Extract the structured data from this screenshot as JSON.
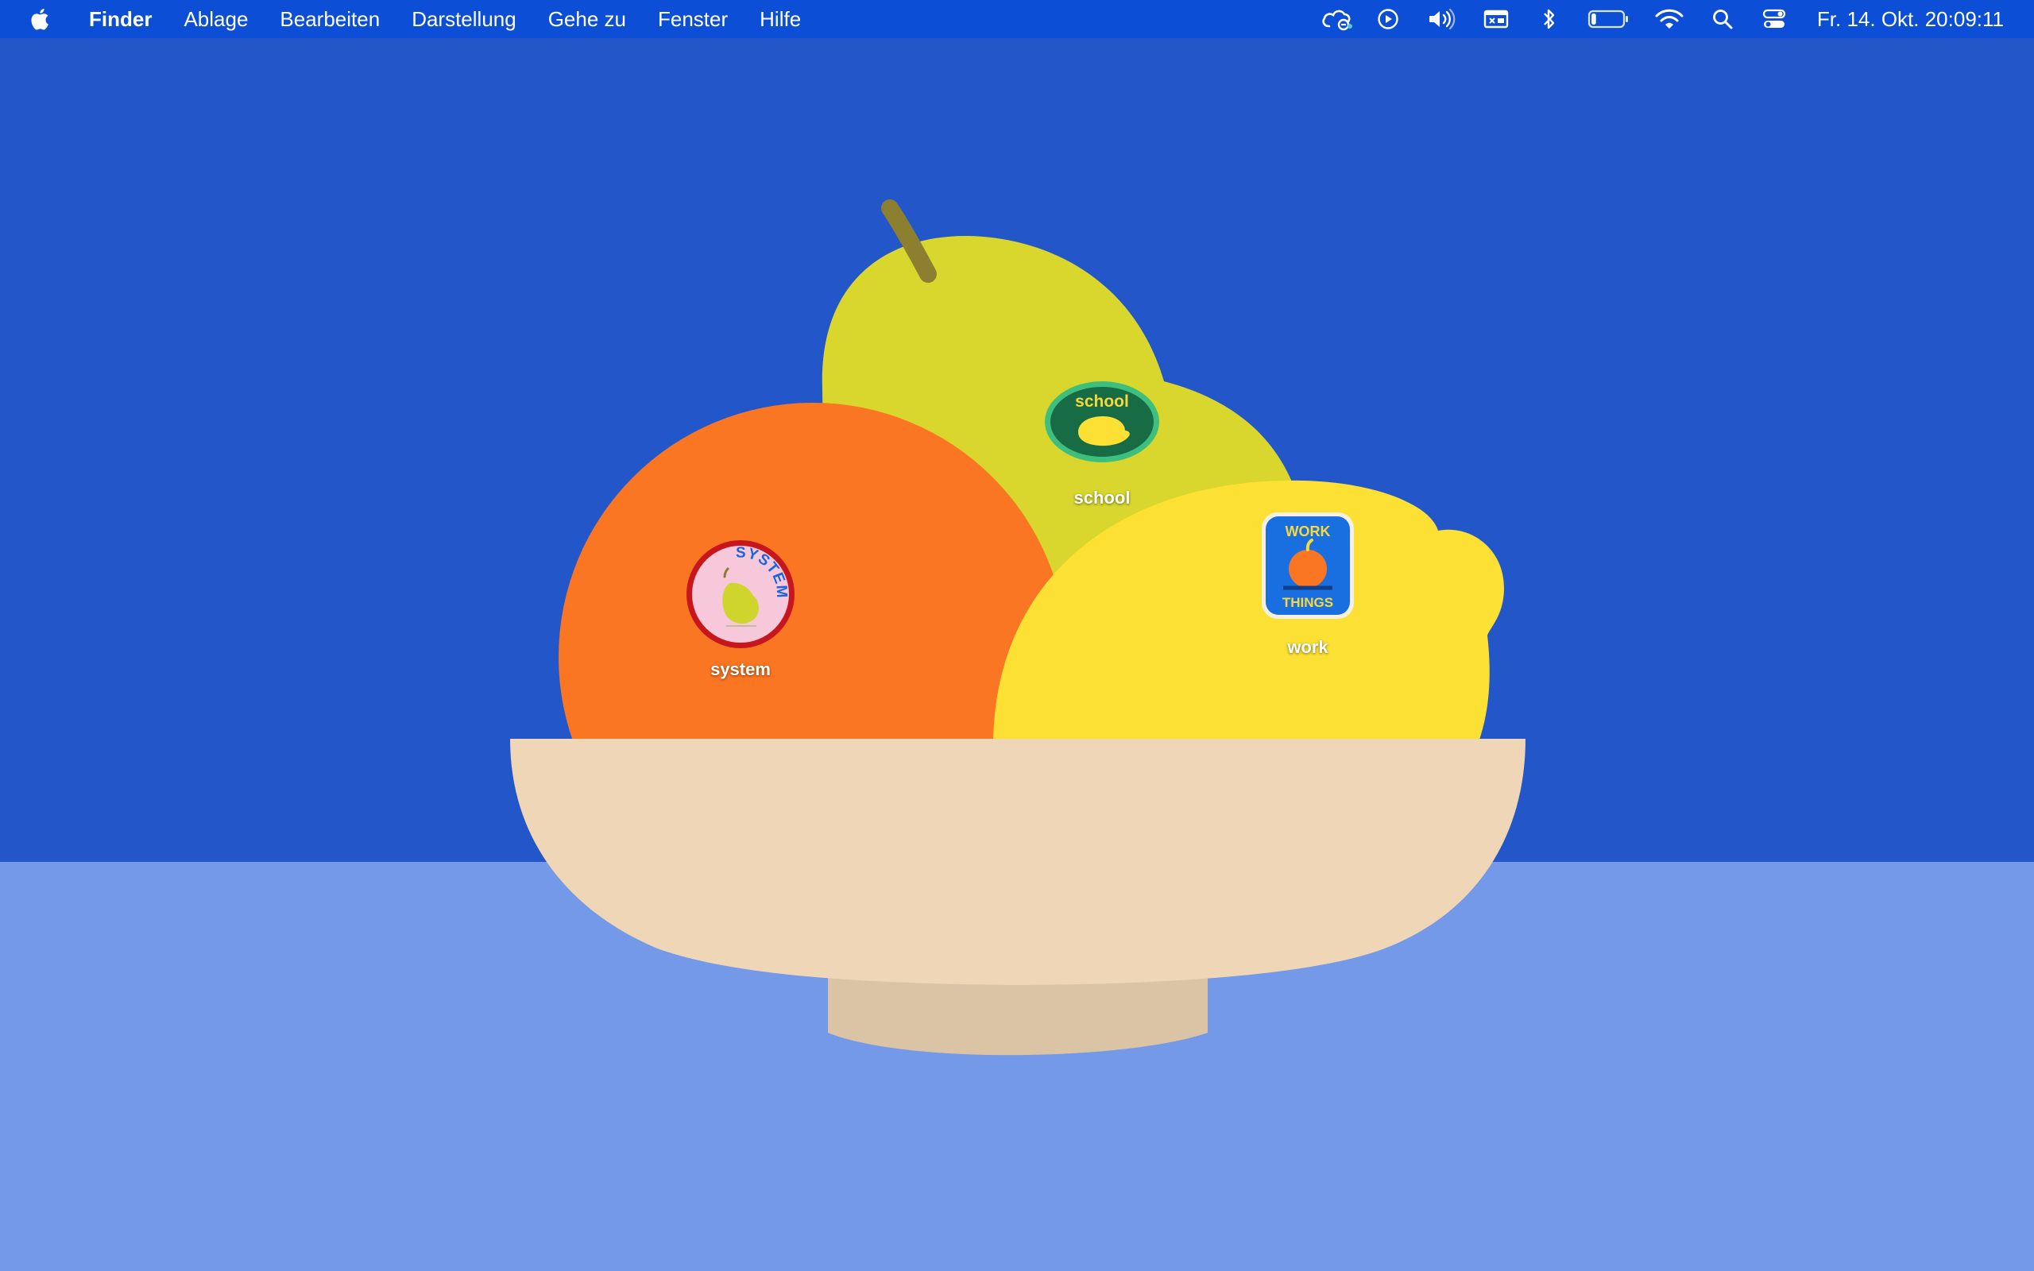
{
  "menubar": {
    "apple_icon": "apple-logo-icon",
    "items": [
      {
        "label": "Finder"
      },
      {
        "label": "Ablage"
      },
      {
        "label": "Bearbeiten"
      },
      {
        "label": "Darstellung"
      },
      {
        "label": "Gehe zu"
      },
      {
        "label": "Fenster"
      },
      {
        "label": "Hilfe"
      }
    ],
    "status_icons": [
      "creative-cloud-icon",
      "play-circle-icon",
      "volume-icon",
      "screen-mirroring-icon",
      "bluetooth-icon",
      "battery-icon",
      "wifi-icon",
      "search-icon",
      "control-center-icon"
    ],
    "battery_level": 0.15,
    "clock": "Fr. 14. Okt.  20:09:11"
  },
  "desktop": {
    "icons": [
      {
        "label": "system",
        "badge_text": "SYSTEM",
        "badge_color": "#c8161d"
      },
      {
        "label": "school",
        "badge_text": "school",
        "badge_color": "#176b45"
      },
      {
        "label": "work",
        "badge_text_top": "WORK",
        "badge_text_bottom": "THINGS",
        "badge_color": "#1a6fe0"
      }
    ]
  },
  "colors": {
    "menubar": "#0d4ed6",
    "wall": "#2356c8",
    "table": "#7499e8",
    "orange": "#fb7622",
    "pear": "#d9d72d",
    "lemon": "#fde034",
    "bowl": "#efd6b6"
  }
}
